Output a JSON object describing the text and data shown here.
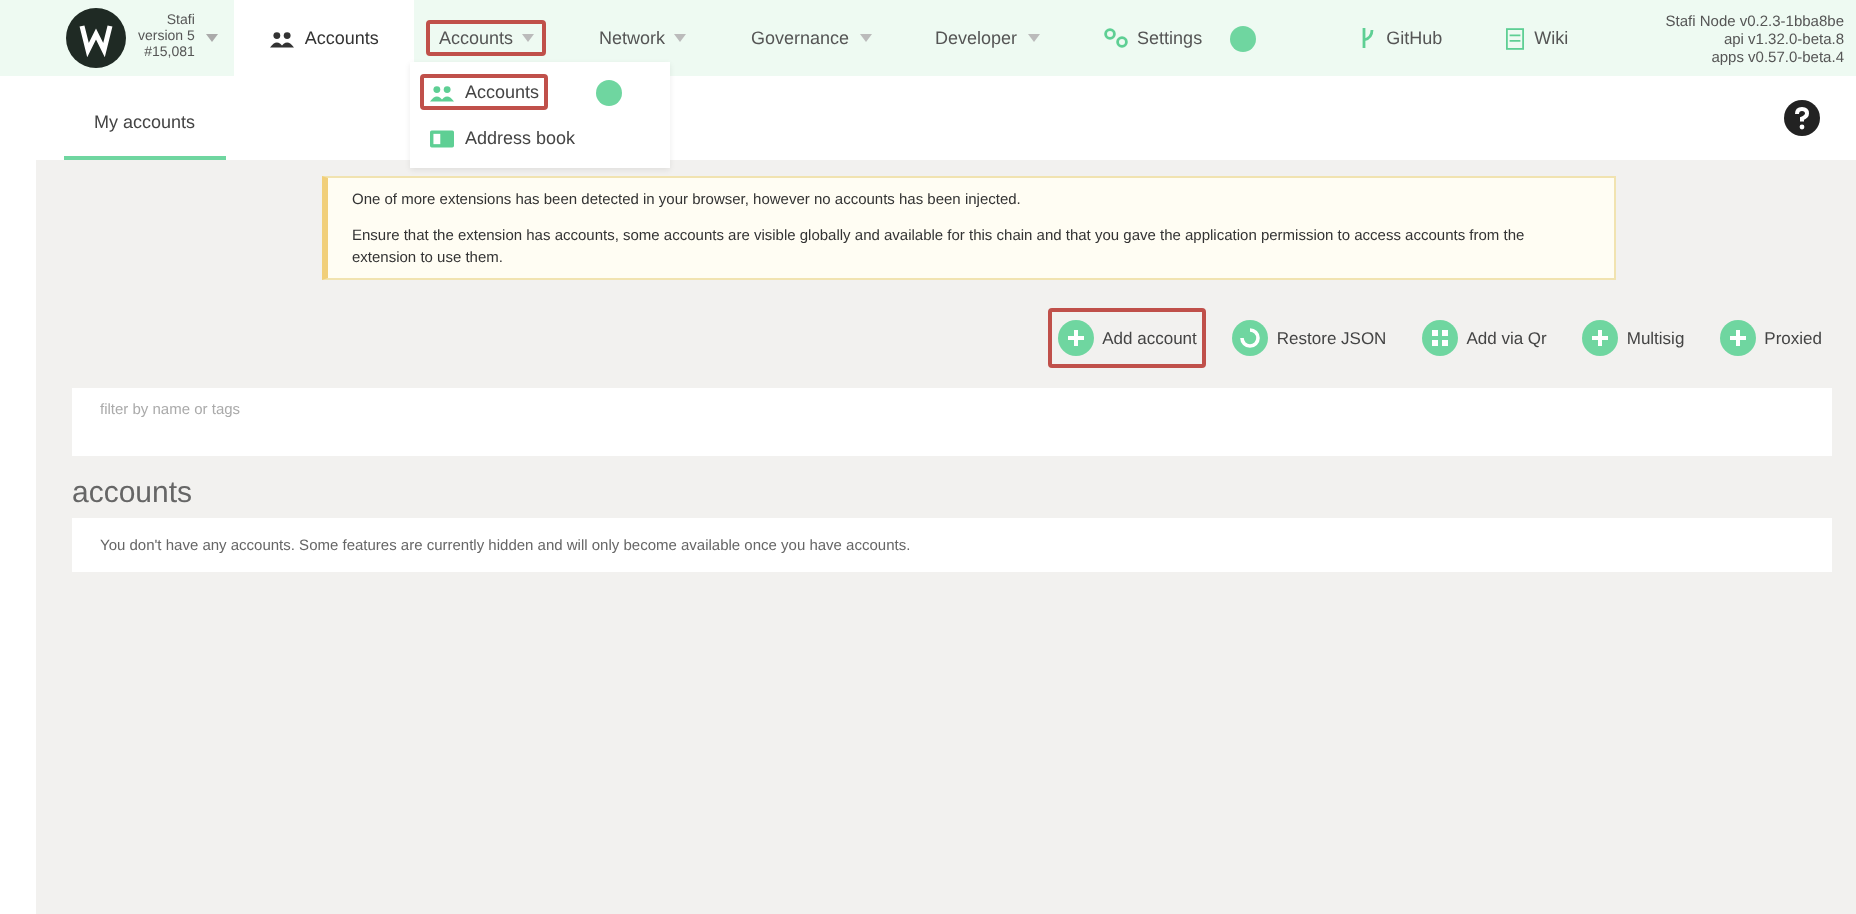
{
  "chain": {
    "name": "Stafi",
    "version": "version 5",
    "block": "#15,081"
  },
  "top_tab": {
    "label": "Accounts",
    "selected": true
  },
  "nav": [
    {
      "label": "Accounts",
      "kind": "menu",
      "highlighted": true,
      "items": [
        {
          "label": "Accounts",
          "kind": "accounts",
          "highlighted": true
        },
        {
          "label": "Address book",
          "kind": "book",
          "highlighted": false
        }
      ]
    },
    {
      "label": "Network",
      "kind": "menu",
      "highlighted": false
    },
    {
      "label": "Governance",
      "kind": "menu",
      "highlighted": false
    },
    {
      "label": "Developer",
      "kind": "menu",
      "highlighted": false
    },
    {
      "label": "Settings",
      "kind": "settings",
      "highlighted": false
    },
    {
      "label": "GitHub",
      "kind": "github",
      "highlighted": false
    },
    {
      "label": "Wiki",
      "kind": "wiki",
      "highlighted": false
    }
  ],
  "versions": [
    "Stafi Node v0.2.3-1bba8be",
    "api v1.32.0-beta.8",
    "apps v0.57.0-beta.4"
  ],
  "subtabs": [
    {
      "label": "My accounts",
      "selected": true
    }
  ],
  "notice": [
    "One of more extensions has been detected in your browser, however no accounts has been injected.",
    "Ensure that the extension has accounts, some accounts are visible globally and available for this chain and that you gave the application permission to access accounts from the extension to use them."
  ],
  "actions": [
    {
      "label": "Add account",
      "kind": "plus",
      "highlighted": true
    },
    {
      "label": "Restore JSON",
      "kind": "restore",
      "highlighted": false
    },
    {
      "label": "Add via Qr",
      "kind": "qr",
      "highlighted": false
    },
    {
      "label": "Multisig",
      "kind": "plus",
      "highlighted": false
    },
    {
      "label": "Proxied",
      "kind": "plus",
      "highlighted": false
    }
  ],
  "filter": {
    "placeholder": "filter by name or tags"
  },
  "section_title": "accounts",
  "empty_message": "You don't have any accounts. Some features are currently hidden and will only become available once you have accounts."
}
